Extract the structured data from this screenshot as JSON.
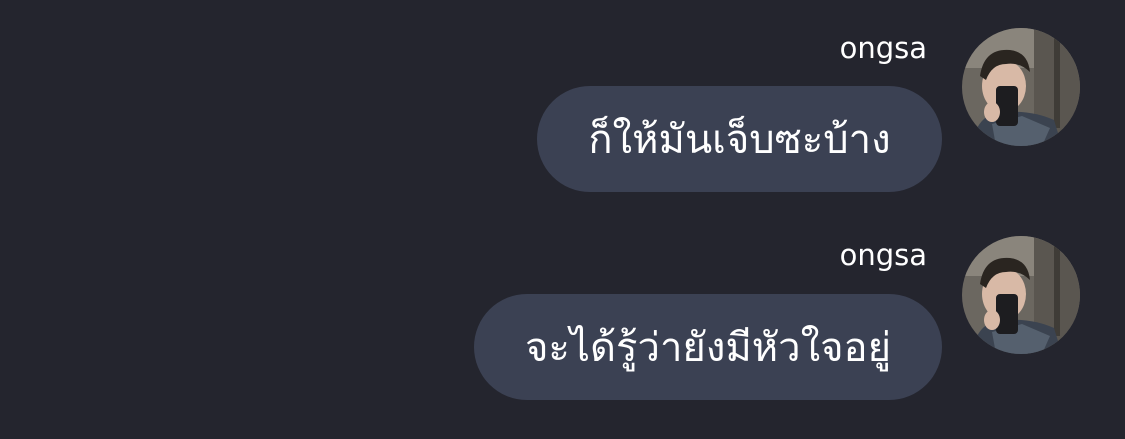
{
  "messages": [
    {
      "sender": "ongsa",
      "text": "ก็ให้มันเจ็บซะบ้าง",
      "avatar_icon": "profile-photo-selfie"
    },
    {
      "sender": "ongsa",
      "text": "จะได้รู้ว่ายังมีหัวใจอยู่",
      "avatar_icon": "profile-photo-selfie"
    }
  ],
  "colors": {
    "background": "#24252e",
    "bubble": "#3b4153",
    "text": "#ffffff"
  }
}
